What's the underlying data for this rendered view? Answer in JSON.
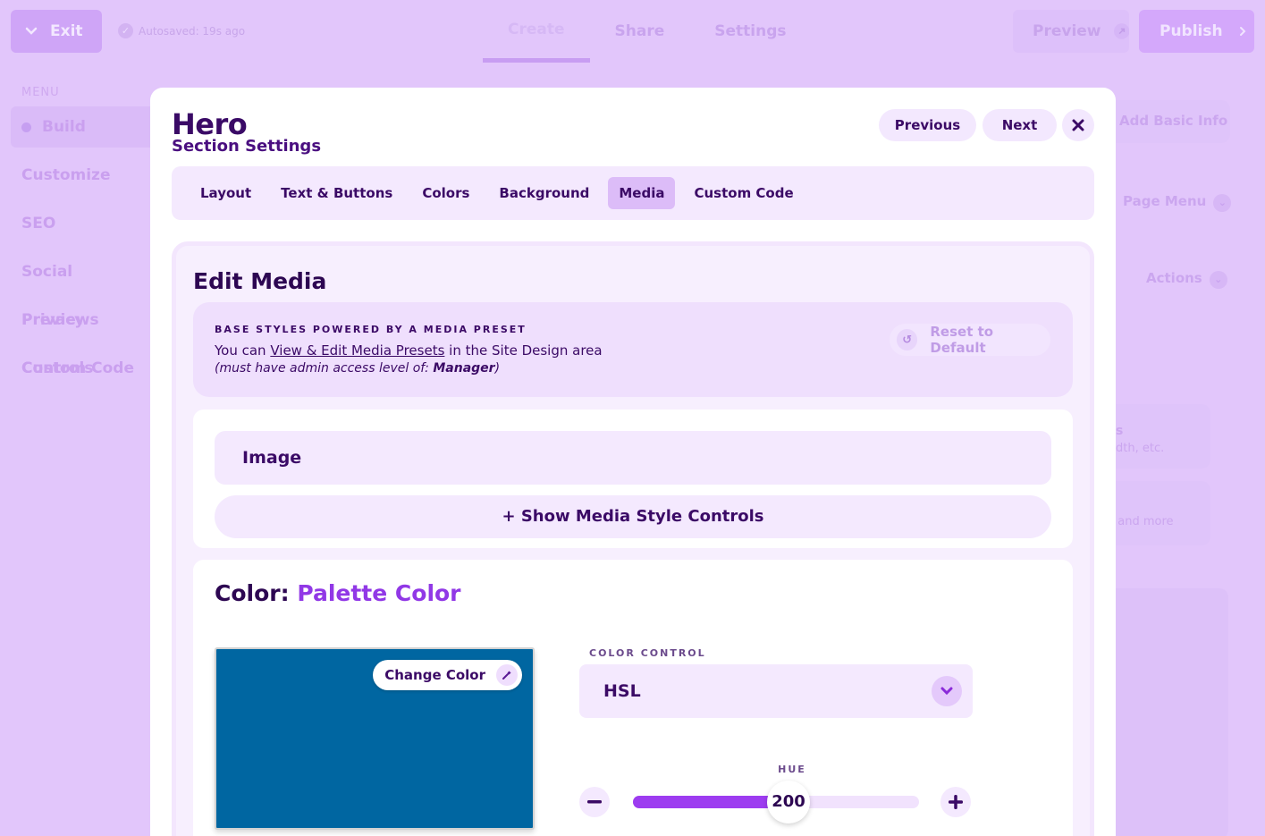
{
  "app": {
    "exit_label": "Exit",
    "autosave": "Autosaved: 19s ago",
    "top_tabs": [
      "Create",
      "Share",
      "Settings"
    ],
    "preview_label": "Preview",
    "publish_label": "Publish"
  },
  "sidebar": {
    "heading": "MENU",
    "items": [
      "Build",
      "Customize",
      "SEO",
      "Social Previews",
      "Privacy Controls",
      "Custom Code"
    ]
  },
  "right_panel": {
    "add_basic_info": "Add Basic Info",
    "page_menu": "Page Menu",
    "actions": "Actions",
    "card1_line1": "s",
    "card1_line2": "dth, etc.",
    "card2_line": ", and more"
  },
  "modal": {
    "title": "Hero",
    "subtitle": "Section Settings",
    "previous_label": "Previous",
    "next_label": "Next",
    "tabs": [
      "Layout",
      "Text & Buttons",
      "Colors",
      "Background",
      "Media",
      "Custom Code"
    ],
    "active_tab": "Media"
  },
  "edit_media": {
    "title": "Edit Media",
    "preset_heading": "BASE STYLES POWERED BY A MEDIA PRESET",
    "preset_text_before": "You can ",
    "preset_link": "View & Edit Media Presets",
    "preset_text_after": " in the Site Design area",
    "preset_note_before": "(must have admin access level of: ",
    "preset_note_level": "Manager",
    "preset_note_after": ")",
    "reset_label": "Reset to Default",
    "image_label": "Image",
    "show_controls_label": "+ Show Media Style Controls"
  },
  "color": {
    "title_prefix": "Color: ",
    "title_value": "Palette Color",
    "swatch_hex": "#0066a1",
    "change_color_label": "Change Color",
    "control_label": "COLOR CONTROL",
    "control_value": "HSL",
    "hue_label": "HUE",
    "hue_value": "200",
    "hue_max": 360,
    "accent_color": "#9d3cf0"
  }
}
